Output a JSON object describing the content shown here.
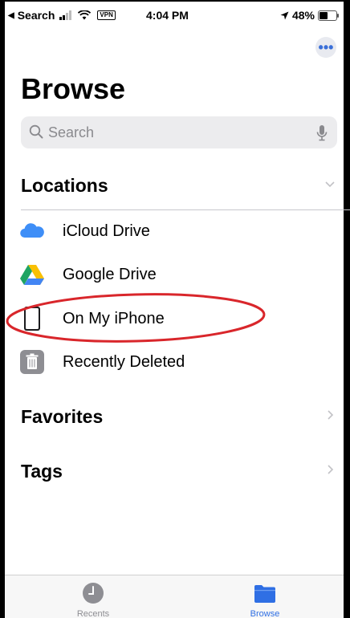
{
  "status_bar": {
    "back_label": "Search",
    "vpn_label": "VPN",
    "time": "4:04 PM",
    "battery": "48%"
  },
  "header": {
    "more_icon": "ellipsis-icon",
    "title": "Browse"
  },
  "search": {
    "placeholder": "Search"
  },
  "sections": {
    "locations": {
      "title": "Locations",
      "items": [
        {
          "label": "iCloud Drive",
          "icon": "icloud-icon"
        },
        {
          "label": "Google Drive",
          "icon": "google-drive-icon"
        },
        {
          "label": "On My iPhone",
          "icon": "iphone-icon"
        },
        {
          "label": "Recently Deleted",
          "icon": "trash-icon"
        }
      ]
    },
    "favorites": {
      "title": "Favorites"
    },
    "tags": {
      "title": "Tags"
    }
  },
  "tab_bar": {
    "tabs": [
      {
        "label": "Recents",
        "icon": "clock-icon"
      },
      {
        "label": "Browse",
        "icon": "folder-icon"
      }
    ]
  },
  "colors": {
    "accent": "#2f6fe4",
    "annotation": "#d9262b"
  }
}
